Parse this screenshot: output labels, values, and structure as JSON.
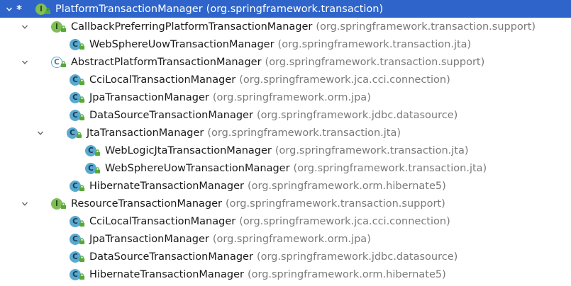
{
  "tree": [
    {
      "name": "PlatformTransactionManager",
      "package": "(org.springframework.transaction)",
      "kind": "interface",
      "badge": "I",
      "depth": 0,
      "expanded": true,
      "selected": true,
      "star": "*"
    },
    {
      "name": "CallbackPreferringPlatformTransactionManager",
      "package": "(org.springframework.transaction.support)",
      "kind": "interface",
      "badge": "I",
      "depth": 1,
      "expanded": true
    },
    {
      "name": "WebSphereUowTransactionManager",
      "package": "(org.springframework.transaction.jta)",
      "kind": "class",
      "badge": "C",
      "depth": 2
    },
    {
      "name": "AbstractPlatformTransactionManager",
      "package": "(org.springframework.transaction.support)",
      "kind": "abstract",
      "badge": "C",
      "depth": 1,
      "expanded": true
    },
    {
      "name": "CciLocalTransactionManager",
      "package": "(org.springframework.jca.cci.connection)",
      "kind": "class",
      "badge": "C",
      "depth": 2
    },
    {
      "name": "JpaTransactionManager",
      "package": "(org.springframework.orm.jpa)",
      "kind": "class",
      "badge": "C",
      "depth": 2
    },
    {
      "name": "DataSourceTransactionManager",
      "package": "(org.springframework.jdbc.datasource)",
      "kind": "class",
      "badge": "C",
      "depth": 2
    },
    {
      "name": "JtaTransactionManager",
      "package": "(org.springframework.transaction.jta)",
      "kind": "class",
      "badge": "C",
      "depth": 2,
      "expanded": true
    },
    {
      "name": "WebLogicJtaTransactionManager",
      "package": "(org.springframework.transaction.jta)",
      "kind": "class",
      "badge": "C",
      "depth": 3
    },
    {
      "name": "WebSphereUowTransactionManager",
      "package": "(org.springframework.transaction.jta)",
      "kind": "class",
      "badge": "C",
      "depth": 3
    },
    {
      "name": "HibernateTransactionManager",
      "package": "(org.springframework.orm.hibernate5)",
      "kind": "class",
      "badge": "C",
      "depth": 2
    },
    {
      "name": "ResourceTransactionManager",
      "package": "(org.springframework.transaction.support)",
      "kind": "interface",
      "badge": "I",
      "depth": 1,
      "expanded": true
    },
    {
      "name": "CciLocalTransactionManager",
      "package": "(org.springframework.jca.cci.connection)",
      "kind": "class",
      "badge": "C",
      "depth": 2
    },
    {
      "name": "JpaTransactionManager",
      "package": "(org.springframework.orm.jpa)",
      "kind": "class",
      "badge": "C",
      "depth": 2
    },
    {
      "name": "DataSourceTransactionManager",
      "package": "(org.springframework.jdbc.datasource)",
      "kind": "class",
      "badge": "C",
      "depth": 2
    },
    {
      "name": "HibernateTransactionManager",
      "package": "(org.springframework.orm.hibernate5)",
      "kind": "class",
      "badge": "C",
      "depth": 2
    }
  ],
  "colors": {
    "selection": "#2f65ca",
    "interface_badge": "#7fbd57",
    "class_badge": "#5aa9cf",
    "lock": "#58a838",
    "package_text": "#7a7a7a"
  },
  "icons": {
    "expand_arrow": "chevron-down-icon",
    "interface": "interface-icon",
    "class": "class-icon",
    "abstract": "abstract-class-icon",
    "visibility": "public-lock-icon"
  }
}
